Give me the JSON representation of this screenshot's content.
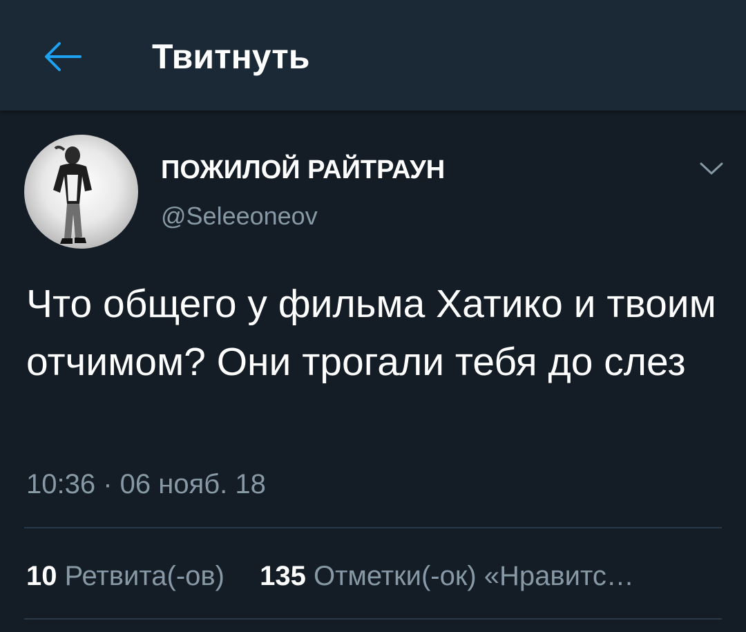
{
  "header": {
    "title": "Твитнуть",
    "back_icon": "arrow-left-icon",
    "accent_color": "#1da1f2"
  },
  "tweet": {
    "author_name": "ПОЖИЛОЙ РАЙТРАУН",
    "author_handle": "@Seleeoneov",
    "text": "Что общего у фильма Хатико и твоим отчимом? Они трогали тебя до слез",
    "timestamp": "10:36 · 06 нояб. 18"
  },
  "stats": {
    "retweets_count": "10",
    "retweets_label": "Ретвита(-ов)",
    "likes_count": "135",
    "likes_label": "Отметки(-ок) «Нравитс…"
  },
  "colors": {
    "background": "#141d26",
    "header_background": "#1b2836",
    "secondary_text": "#8899a6",
    "divider": "#2a3947"
  }
}
